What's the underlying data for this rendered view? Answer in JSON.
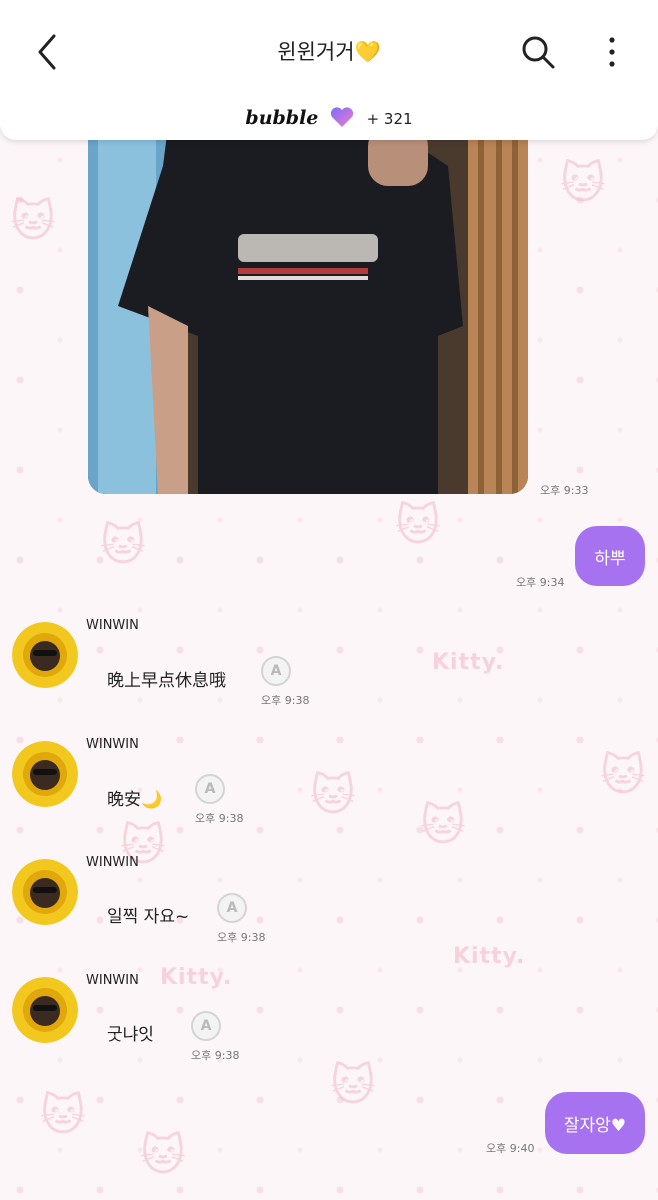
{
  "header": {
    "title": "윈윈거거",
    "title_emoji": "💛",
    "brand": "bubble",
    "follower_count": "+ 321",
    "icons": {
      "back": "chevron-left-icon",
      "search": "search-icon",
      "more": "more-vertical-icon",
      "brand": "heart-icon"
    }
  },
  "colors": {
    "outgoing_bubble": "#a772f0",
    "header_bg": "#ffffff",
    "title_heart": "#f5c518"
  },
  "wallpaper": {
    "text_1": "Kitty.",
    "text_2": "Kitty.",
    "text_3": "Kitty."
  },
  "messages": [
    {
      "type": "image",
      "direction": "in",
      "time": "오후 9:33"
    },
    {
      "type": "text",
      "direction": "out",
      "text": "하뿌",
      "time": "오후 9:34"
    },
    {
      "type": "text",
      "direction": "in",
      "sender": "WINWIN",
      "text": "晚上早点休息哦",
      "read_mark": "A",
      "time": "오후 9:38"
    },
    {
      "type": "text",
      "direction": "in",
      "sender": "WINWIN",
      "text": "晚安🌙",
      "read_mark": "A",
      "time": "오후 9:38"
    },
    {
      "type": "text",
      "direction": "in",
      "sender": "WINWIN",
      "text": "일찍 자요~",
      "read_mark": "A",
      "time": "오후 9:38"
    },
    {
      "type": "text",
      "direction": "in",
      "sender": "WINWIN",
      "text": "굿냐잇",
      "read_mark": "A",
      "time": "오후 9:38"
    },
    {
      "type": "text",
      "direction": "out",
      "text": "잘자앙♥",
      "time": "오후 9:40"
    }
  ]
}
